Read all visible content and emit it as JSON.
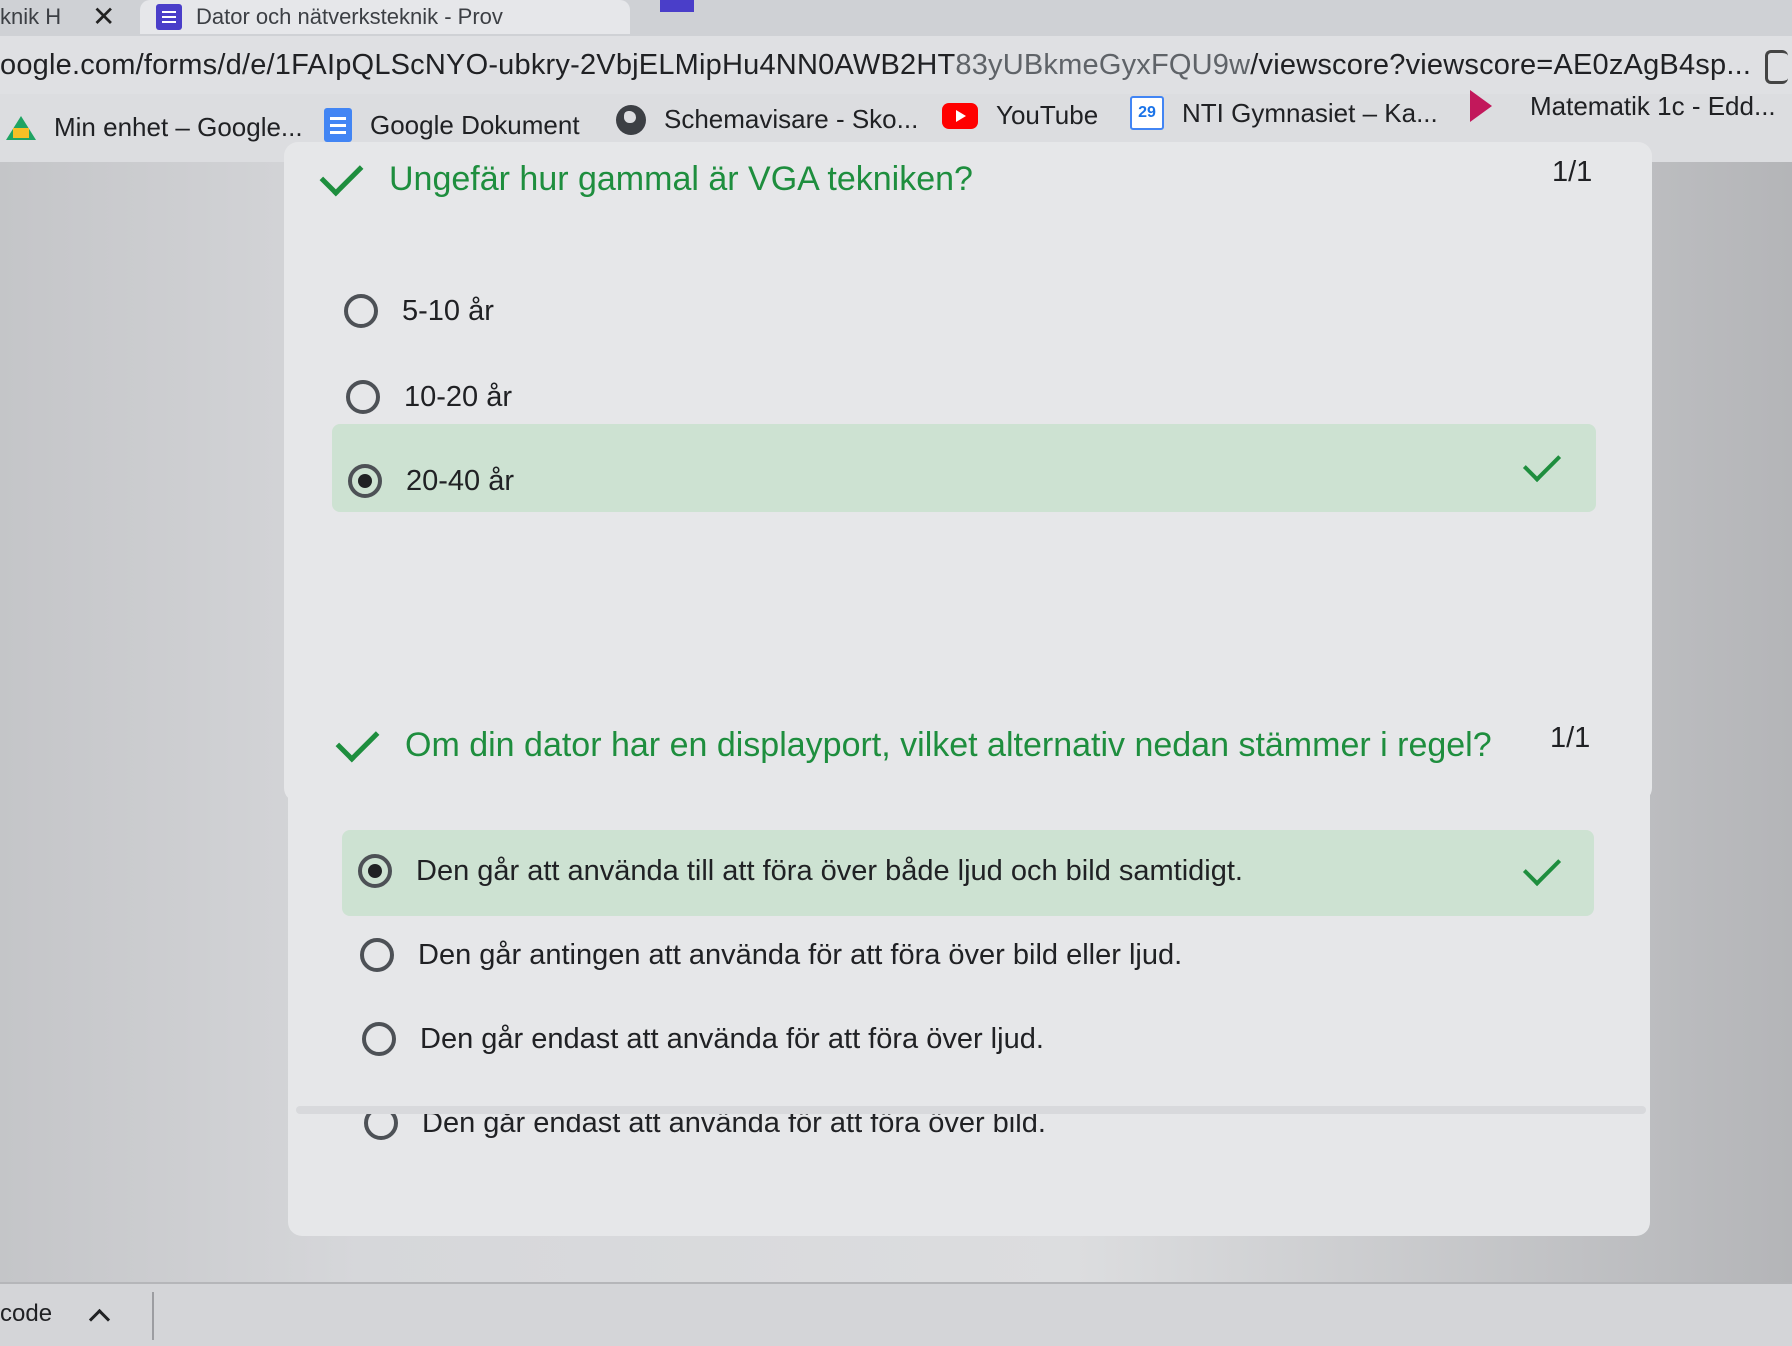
{
  "browser": {
    "tabs": [
      {
        "label": "knik H"
      },
      {
        "label": "Dator och nätverksteknik - Prov"
      }
    ],
    "url_prefix": "oogle.com/forms/d/e/1FAIpQLScNYO-ubkry-2VbjELMipHu4NN0AWB2HT",
    "url_dim": "83yUBkmeGyxFQU9w",
    "url_suffix": "/viewscore?viewscore=AE0zAgB4sp...",
    "bookmarks": [
      {
        "label": "Min enhet – Google...",
        "icon": "google-drive-icon"
      },
      {
        "label": "Google Dokument",
        "icon": "google-docs-icon"
      },
      {
        "label": "Schemavisare - Sko...",
        "icon": "globe-icon"
      },
      {
        "label": "YouTube",
        "icon": "youtube-icon"
      },
      {
        "label": "NTI Gymnasiet – Ka...",
        "icon": "calendar-icon",
        "icon_text": "29"
      },
      {
        "label": "Matematik 1c - Edd...",
        "icon": "eddler-icon"
      }
    ]
  },
  "questions": [
    {
      "title": "Ungefär hur gammal är VGA tekniken?",
      "score": "1/1",
      "options": [
        {
          "label": "5-10 år",
          "selected": false
        },
        {
          "label": "10-20 år",
          "selected": false
        },
        {
          "label": "20-40 år",
          "selected": true,
          "correct": true
        }
      ]
    },
    {
      "title": "Om din dator har en displayport, vilket alternativ nedan stämmer i regel?",
      "score": "1/1",
      "options": [
        {
          "label": "Den går att använda till att föra över både ljud och bild samtidigt.",
          "selected": true,
          "correct": true
        },
        {
          "label": "Den går antingen att använda för att föra över bild eller ljud.",
          "selected": false
        },
        {
          "label": "Den går endast att använda för att föra över ljud.",
          "selected": false
        },
        {
          "label": "Den går endast att använda för att föra över bild.",
          "selected": false
        }
      ]
    }
  ],
  "downloads": {
    "item_label": "code"
  },
  "colors": {
    "correct_green": "#1e8e3e",
    "correct_band": "#cde2d2"
  }
}
